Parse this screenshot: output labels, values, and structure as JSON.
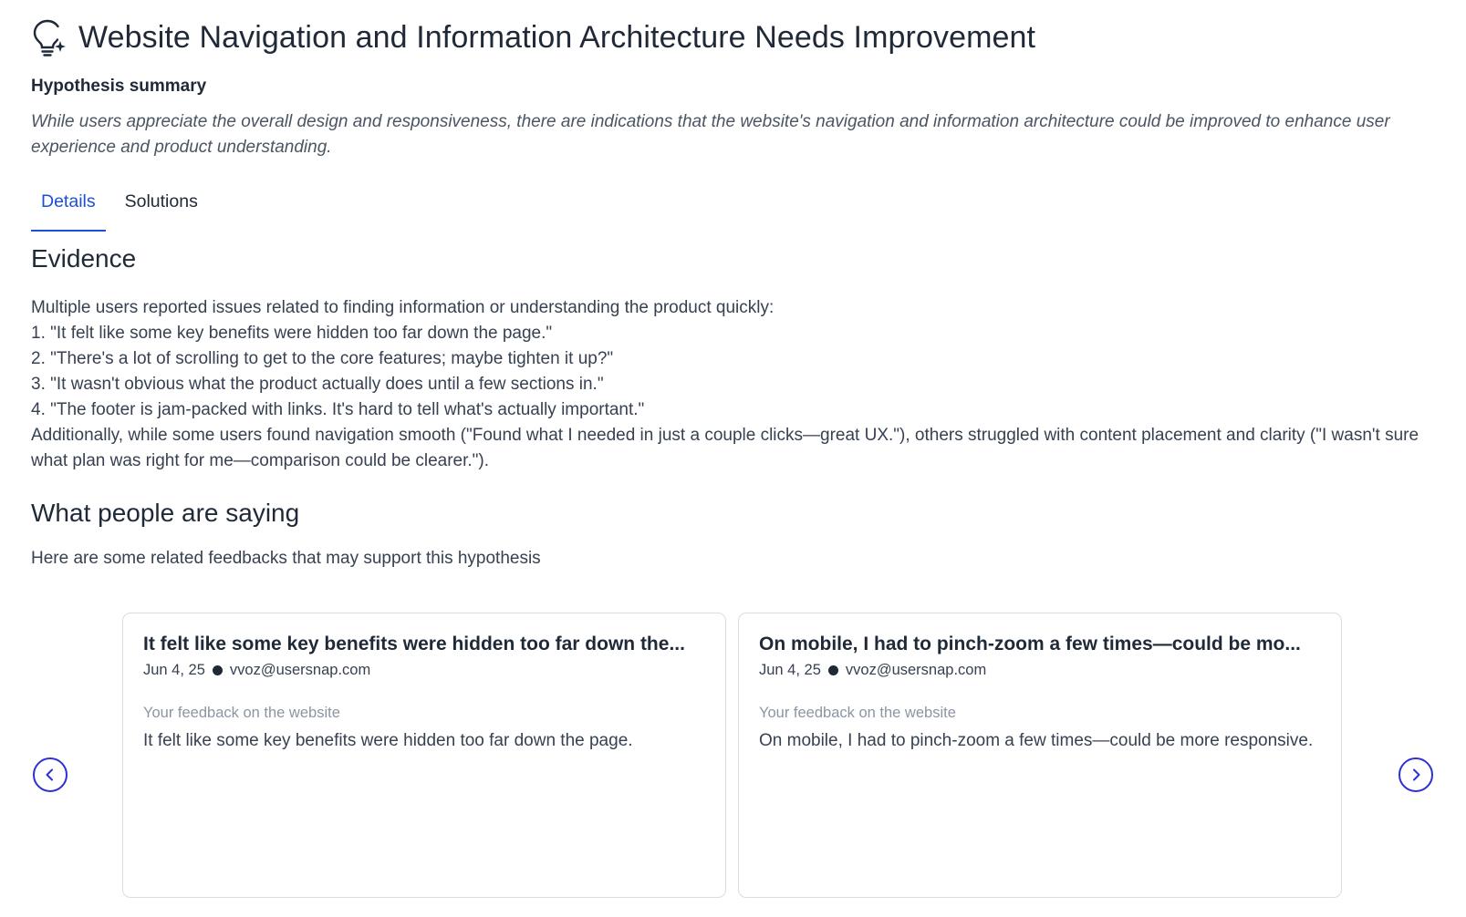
{
  "header": {
    "title": "Website Navigation and Information Architecture Needs Improvement",
    "icon": "lightbulb-sparkle-icon"
  },
  "summary": {
    "label": "Hypothesis summary",
    "text": "While users appreciate the overall design and responsiveness, there are indications that the website's navigation and information architecture could be improved to enhance user experience and product understanding."
  },
  "tabs": [
    {
      "label": "Details",
      "active": true
    },
    {
      "label": "Solutions",
      "active": false
    }
  ],
  "evidence": {
    "heading": "Evidence",
    "lines": [
      "Multiple users reported issues related to finding information or understanding the product quickly:",
      "1. \"It felt like some key benefits were hidden too far down the page.\"",
      "2. \"There's a lot of scrolling to get to the core features; maybe tighten it up?\"",
      "3. \"It wasn't obvious what the product actually does until a few sections in.\"",
      "4. \"The footer is jam-packed with links. It's hard to tell what's actually important.\"",
      "Additionally, while some users found navigation smooth (\"Found what I needed in just a couple clicks—great UX.\"), others struggled with content placement and clarity (\"I wasn't sure what plan was right for me—comparison could be clearer.\")."
    ]
  },
  "saying": {
    "heading": "What people are saying",
    "subtitle": "Here are some related feedbacks that may support this hypothesis"
  },
  "cards": [
    {
      "title": "It felt like some key benefits were hidden too far down the...",
      "date": "Jun 4, 25",
      "email": "vvoz@usersnap.com",
      "question": "Your feedback on the website",
      "answer": "It felt like some key benefits were hidden too far down the page."
    },
    {
      "title": "On mobile, I had to pinch-zoom a few times—could be mo...",
      "date": "Jun 4, 25",
      "email": "vvoz@usersnap.com",
      "question": "Your feedback on the website",
      "answer": "On mobile, I had to pinch-zoom a few times—could be more responsive."
    }
  ],
  "carousel": {
    "prev_icon": "chevron-left-icon",
    "next_icon": "chevron-right-icon"
  },
  "colors": {
    "accent": "#1d4ed8",
    "nav_button": "#2f2fd6",
    "muted": "#8b95a3",
    "border": "#d9dde3"
  }
}
